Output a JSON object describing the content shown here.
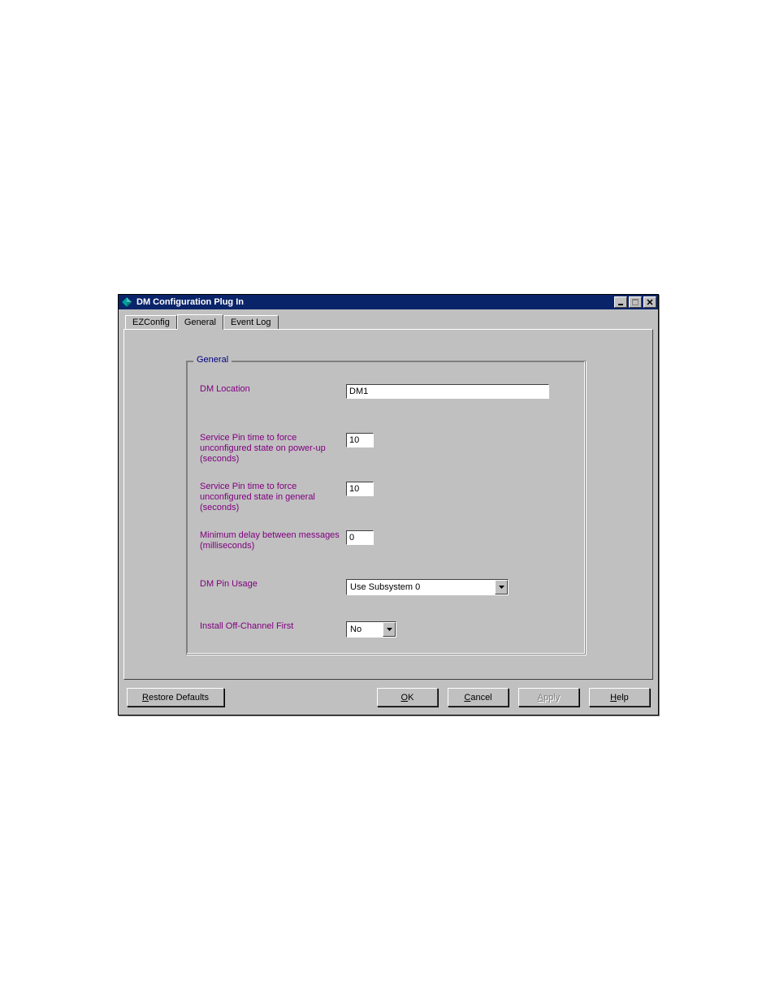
{
  "window": {
    "title": "DM Configuration Plug In"
  },
  "tabs": {
    "ezconfig": "EZConfig",
    "general": "General",
    "eventlog": "Event Log"
  },
  "groupbox": {
    "title": "General"
  },
  "fields": {
    "dm_location": {
      "label": "DM Location",
      "value": "DM1"
    },
    "service_pin_powerup": {
      "label": "Service Pin time to force unconfigured state on power-up (seconds)",
      "value": "10"
    },
    "service_pin_general": {
      "label": "Service Pin time to force unconfigured state in general (seconds)",
      "value": "10"
    },
    "min_delay": {
      "label": "Minimum delay between messages (milliseconds)",
      "value": "0"
    },
    "dm_pin_usage": {
      "label": "DM Pin Usage",
      "value": "Use Subsystem 0"
    },
    "install_off_channel": {
      "label": "Install Off-Channel First",
      "value": "No"
    }
  },
  "buttons": {
    "restore_defaults": "Restore Defaults",
    "ok": "OK",
    "cancel": "Cancel",
    "apply": "Apply",
    "help": "Help"
  }
}
